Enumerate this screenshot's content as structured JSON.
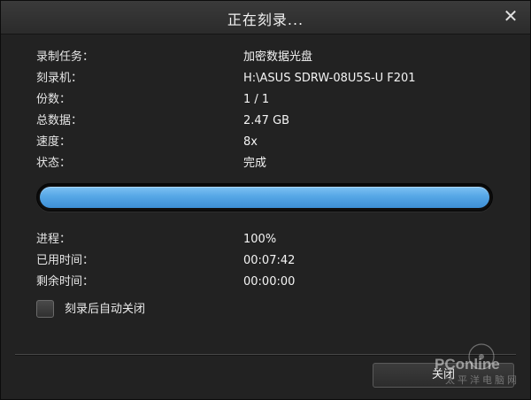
{
  "window": {
    "title": "正在刻录..."
  },
  "title_bar": {
    "close_symbol": "✕"
  },
  "info": [
    {
      "label": "录制任务：",
      "value": "加密数据光盘"
    },
    {
      "label": "刻录机：",
      "value": "H:\\ASUS SDRW-08U5S-U F201"
    },
    {
      "label": "份数：",
      "value": "1 / 1"
    },
    {
      "label": "总数据：",
      "value": "2.47 GB"
    },
    {
      "label": "速度：",
      "value": "8x"
    },
    {
      "label": "状态：",
      "value": "完成"
    }
  ],
  "progress": {
    "fraction": 1.0,
    "color": "#56a7e6"
  },
  "stats": [
    {
      "label": "进程：",
      "value": "100%"
    },
    {
      "label": "已用时间：",
      "value": "00:07:42"
    },
    {
      "label": "剩余时间：",
      "value": "00:00:00"
    }
  ],
  "auto_close": {
    "label": "刻录后自动关闭",
    "checked": false
  },
  "buttons": {
    "close_label": "关闭"
  },
  "watermark": {
    "brand": "PConline",
    "subtitle": "太平洋电脑网"
  }
}
